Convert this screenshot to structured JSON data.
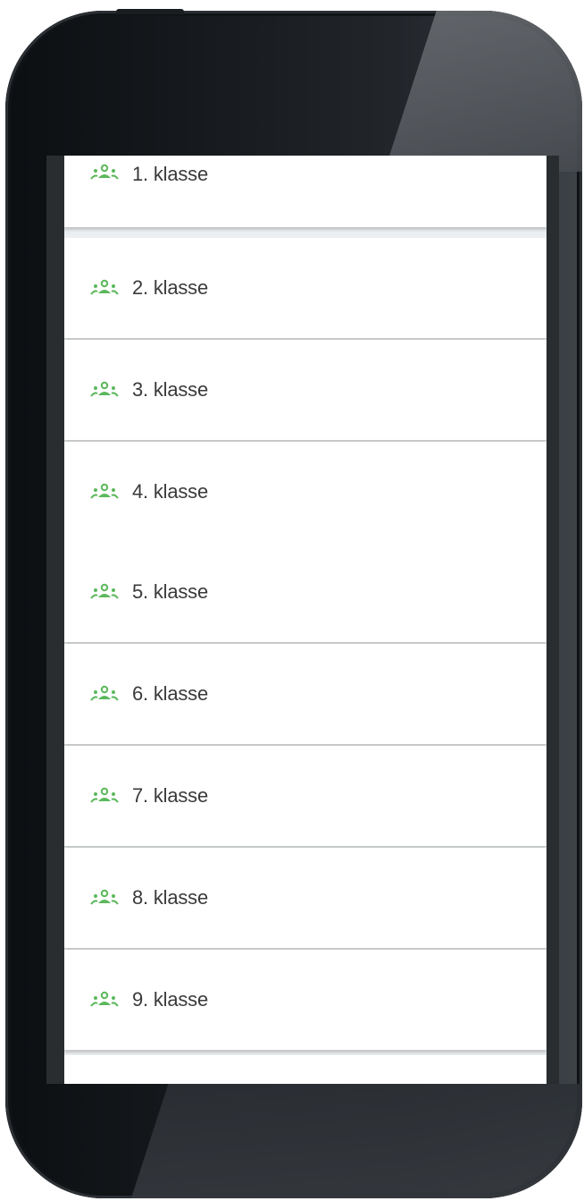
{
  "classes": {
    "icon": "groups-icon",
    "icon_color": "#5cb85c",
    "items": [
      {
        "label": "1. klasse"
      },
      {
        "label": "2. klasse"
      },
      {
        "label": "3. klasse"
      },
      {
        "label": "4. klasse"
      },
      {
        "label": "5. klasse"
      },
      {
        "label": "6. klasse"
      },
      {
        "label": "7. klasse"
      },
      {
        "label": "8. klasse"
      },
      {
        "label": "9. klasse"
      }
    ]
  }
}
